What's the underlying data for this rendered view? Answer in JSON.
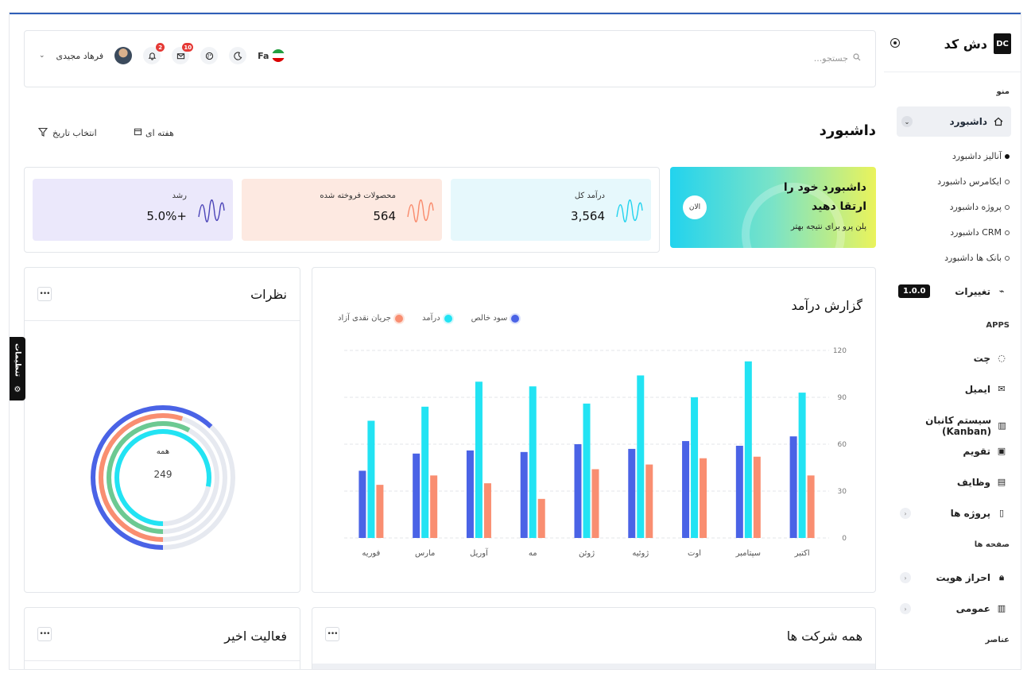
{
  "brand": {
    "name": "دش کد",
    "logo_letters": "DC"
  },
  "sidebar": {
    "menu_title": "منو",
    "dashboard_label": "داشبورد",
    "sub_items": [
      "آنالیز داشبورد",
      "ایکامرس داشبورد",
      "پروژه داشبورد",
      "CRM داشبورد",
      "بانک ها داشبورد"
    ],
    "changelog_label": "تغییرات",
    "version": "1.0.0",
    "apps_title": "APPS",
    "apps": [
      "چت",
      "ایمیل",
      "سیستم کانبان (Kanban)",
      "تقویم",
      "وظایف",
      "پروژه ها"
    ],
    "pages_title": "صفحه ها",
    "pages": [
      "احراز هویت",
      "عمومی"
    ],
    "elements_title": "عناصر"
  },
  "header": {
    "search_placeholder": "جستجو...",
    "lang": "Fa",
    "mail_count": "10",
    "bell_count": "2",
    "user_name": "فرهاد مجیدی"
  },
  "page": {
    "title": "داشبورد",
    "week_label": "هفته ای",
    "date_label": "انتخاب تاریخ"
  },
  "promo": {
    "title": "داشبورد خود را ارتقا دهید",
    "subtitle": "پلن پرو برای نتیجه بهتر",
    "button": "الان"
  },
  "stats": [
    {
      "label": "درآمد کل",
      "value": "3,564",
      "bg": "#e6f8fc",
      "stroke": "#22d3ee"
    },
    {
      "label": "محصولات فروخته شده",
      "value": "564",
      "bg": "#fde9e1",
      "stroke": "#f98a6b"
    },
    {
      "label": "رشد",
      "value": "+5.0%",
      "bg": "#ebe8fb",
      "stroke": "#4c45b8"
    }
  ],
  "revenue_card": {
    "title": "گزارش درآمد"
  },
  "comments_card": {
    "title": "نظرات",
    "center_label": "همه",
    "center_value": "249"
  },
  "activity_card": {
    "title": "فعالیت اخیر"
  },
  "companies_card": {
    "title": "همه شرکت ها"
  },
  "settings_tab": {
    "label": "تنظیمات"
  },
  "colors": {
    "blue": "#4a63e6",
    "cyan": "#22e3f3",
    "orange": "#f98e71",
    "green": "#6cc992"
  },
  "chart_data": {
    "type": "bar",
    "title": "گزارش درآمد",
    "categories": [
      "اکتبر",
      "سپتامبر",
      "اوت",
      "ژوئیه",
      "ژوئن",
      "مه",
      "آوریل",
      "مارس",
      "فوریه"
    ],
    "series": [
      {
        "name": "سود خالص",
        "color": "#4a63e6",
        "values": [
          65,
          59,
          62,
          57,
          60,
          55,
          56,
          54,
          43
        ]
      },
      {
        "name": "درآمد",
        "color": "#22e3f3",
        "values": [
          93,
          113,
          90,
          104,
          86,
          97,
          100,
          84,
          75
        ]
      },
      {
        "name": "جریان نقدی آزاد",
        "color": "#f98e71",
        "values": [
          40,
          52,
          51,
          47,
          44,
          25,
          35,
          40,
          34
        ]
      }
    ],
    "yticks": [
      0,
      30,
      60,
      90,
      120
    ],
    "ylim": [
      0,
      120
    ],
    "grid": true,
    "legend": "top"
  }
}
